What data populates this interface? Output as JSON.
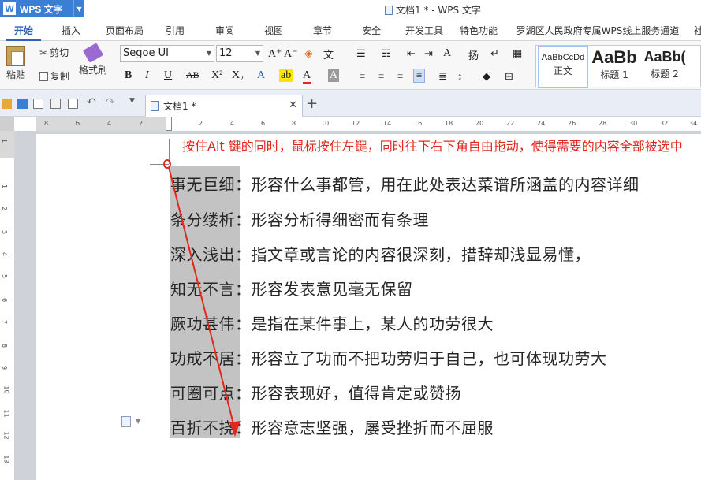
{
  "app": {
    "name": "WPS 文字",
    "logo": "W",
    "window_title": "文档1 * - WPS 文字"
  },
  "tabs": [
    "开始",
    "插入",
    "页面布局",
    "引用",
    "审阅",
    "视图",
    "章节",
    "安全",
    "开发工具",
    "特色功能",
    "罗湖区人民政府专属WPS线上服务通道",
    "社"
  ],
  "ribbon": {
    "paste": "粘贴",
    "cut": "剪切",
    "copy": "复制",
    "format_painter": "格式刷",
    "font_name": "Segoe UI",
    "font_size": "12",
    "styles": [
      {
        "sample": "AaBbCcDd",
        "name": "正文"
      },
      {
        "sample": "AaBb",
        "name": "标题 1"
      },
      {
        "sample": "AaBb(",
        "name": "标题 2"
      }
    ]
  },
  "doc_tab": {
    "label": "文档1 *"
  },
  "ruler": {
    "h_left": [
      "8",
      "6",
      "4",
      "2"
    ],
    "h_right": [
      "2",
      "4",
      "6",
      "8",
      "10",
      "12",
      "14",
      "16",
      "18",
      "20",
      "22",
      "24",
      "26",
      "28",
      "30",
      "32",
      "34"
    ],
    "v": [
      "1",
      "1",
      "2",
      "3",
      "4",
      "5",
      "6",
      "7",
      "8",
      "9",
      "10",
      "11",
      "12",
      "13"
    ]
  },
  "annotation": "按住Alt 键的同时，鼠标按住左键，同时往下右下角自由拖动，使得需要的内容全部被选中",
  "content_lines": [
    "事无巨细：形容什么事都管，用在此处表达菜谱所涵盖的内容详细",
    "条分缕析：形容分析得细密而有条理",
    "深入浅出：指文章或言论的内容很深刻，措辞却浅显易懂，",
    "知无不言：形容发表意见毫无保留",
    "厥功甚伟：是指在某件事上，某人的功劳很大",
    "功成不居：形容立了功而不把功劳归于自己，也可体现功劳大",
    "可圈可点：形容表现好，值得肯定或赞扬",
    "百折不挠：形容意志坚强，屡受挫折而不屈服"
  ],
  "colors": {
    "accent": "#3c7ed4",
    "annotation_red": "#e0281c",
    "selection": "#c3c3c3"
  }
}
